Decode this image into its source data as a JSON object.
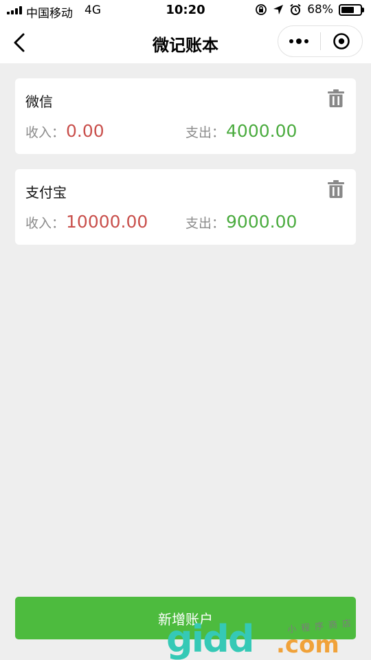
{
  "status_bar": {
    "carrier": "中国移动",
    "network": "4G",
    "time": "10:20",
    "battery": "68%",
    "battery_level": 0.68
  },
  "nav": {
    "title": "微记账本"
  },
  "accounts": [
    {
      "name": "微信",
      "income_label": "收入：",
      "income": "0.00",
      "expense_label": "支出：",
      "expense": "4000.00"
    },
    {
      "name": "支付宝",
      "income_label": "收入：",
      "income": "10000.00",
      "expense_label": "支出：",
      "expense": "9000.00"
    }
  ],
  "add_button": {
    "label": "新增账户"
  },
  "watermark": {
    "brand": "gidd",
    "suffix": ".com",
    "tagline": "小程序商店"
  },
  "colors": {
    "income": "#c9504c",
    "expense": "#4aab3e",
    "button": "#4dbb3e",
    "background": "#eeeeee"
  }
}
